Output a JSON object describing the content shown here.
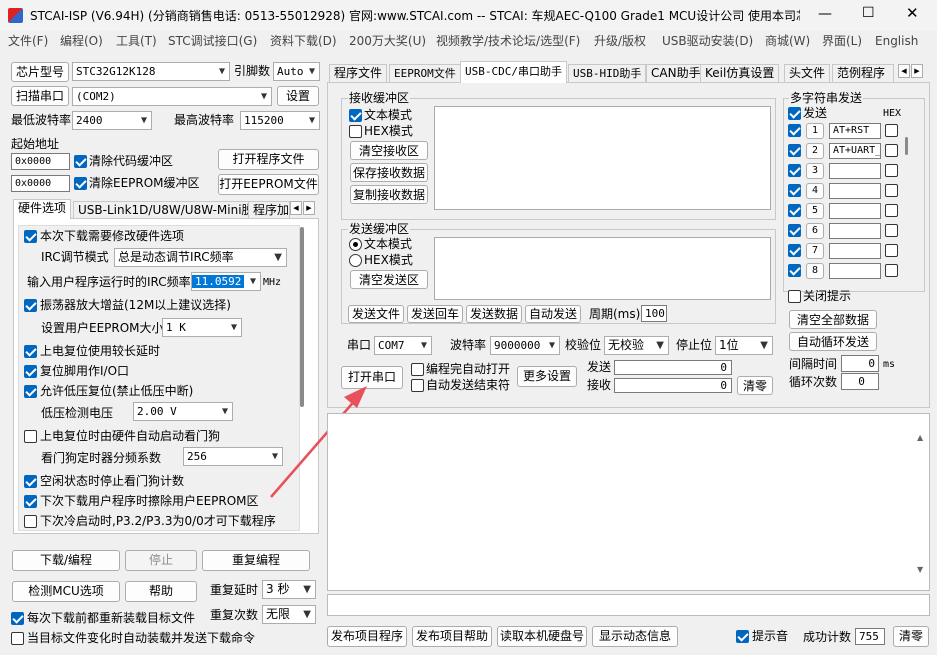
{
  "titlebar": {
    "title": "STCAI-ISP (V6.94H) (分销商销售电话: 0513-55012928) 官网:www.STCAI.com -- STCAI: 车规AEC-Q100 Grade1 MCU设计公司 使用本司芯片或采…"
  },
  "menubar": [
    "文件(F)",
    "编程(O)",
    "工具(T)",
    "STC调试接口(G)",
    "资料下载(D)",
    "200万大奖(U)",
    "视频教学/技术论坛/选型(F)",
    "升级/版权",
    "USB驱动安装(D)",
    "商城(W)",
    "界面(L)",
    "English"
  ],
  "left": {
    "chip_btn": "芯片型号",
    "chip_value": "STC32G12K128",
    "pins_label": "引脚数",
    "pins_value": "Auto",
    "scan_btn": "扫描串口",
    "port_value": "(COM2)",
    "settings_btn": "设置",
    "min_baud_label": "最低波特率",
    "min_baud": "2400",
    "max_baud_label": "最高波特率",
    "max_baud": "115200",
    "start_addr_label": "起始地址",
    "addr1": "0x0000",
    "clear_code": "清除代码缓冲区",
    "open_prog": "打开程序文件",
    "addr2": "0x0000",
    "clear_eeprom": "清除EEPROM缓冲区",
    "open_eeprom": "打开EEPROM文件",
    "tabs": [
      "硬件选项",
      "USB-Link1D/U8W/U8W-Mini脱机",
      "程序加"
    ],
    "hw": {
      "o1": "本次下载需要修改硬件选项",
      "irc_mode_label": "IRC调节模式",
      "irc_mode": "总是动态调节IRC频率",
      "irc_freq_label": "输入用户程序运行时的IRC频率",
      "irc_freq": "11.0592",
      "mhz": "MHz",
      "o2": "振荡器放大增益(12M以上建议选择)",
      "eeprom_size_label": "设置用户EEPROM大小",
      "eeprom_size": "1  K",
      "o3": "上电复位使用较长延时",
      "o4": "复位脚用作I/O口",
      "o5": "允许低压复位(禁止低压中断)",
      "lv_label": "低压检测电压",
      "lv_value": "2.00 V",
      "o6": "上电复位时由硬件自动启动看门狗",
      "wdt_label": "看门狗定时器分频系数",
      "wdt_value": "256",
      "o7": "空闲状态时停止看门狗计数",
      "o8": "下次下载用户程序时擦除用户EEPROM区",
      "o9": "下次冷启动时,P3.2/P3.3为0/0才可下载程序"
    },
    "download_btn": "下载/编程",
    "stop_btn": "停止",
    "reprog_btn": "重复编程",
    "detect_btn": "检测MCU选项",
    "help_btn": "帮助",
    "repeat_delay_label": "重复延时",
    "repeat_delay": "3 秒",
    "repeat_count_label": "重复次数",
    "repeat_count": "无限",
    "reload": "每次下载前都重新装载目标文件",
    "autosend": "当目标文件变化时自动装载并发送下载命令"
  },
  "right": {
    "tabs": [
      "程序文件",
      "EEPROM文件",
      "USB-CDC/串口助手",
      "USB-HID助手",
      "CAN助手",
      "Keil仿真设置",
      "头文件",
      "范例程序"
    ],
    "recv": {
      "title": "接收缓冲区",
      "text_mode": "文本模式",
      "hex_mode": "HEX模式",
      "clear": "清空接收区",
      "save": "保存接收数据",
      "copy": "复制接收数据"
    },
    "send": {
      "title": "发送缓冲区",
      "text_mode": "文本模式",
      "hex_mode": "HEX模式",
      "clear": "清空发送区",
      "send_file": "发送文件",
      "send_enter": "发送回车",
      "send_data": "发送数据",
      "auto_send": "自动发送",
      "period_label": "周期(ms)",
      "period": "100"
    },
    "multi": {
      "title": "多字符串发送",
      "send_label": "发送",
      "hex_label": "HEX",
      "rows": [
        {
          "n": "1",
          "v": "AT+RST"
        },
        {
          "n": "2",
          "v": "AT+UART_"
        },
        {
          "n": "3",
          "v": ""
        },
        {
          "n": "4",
          "v": ""
        },
        {
          "n": "5",
          "v": ""
        },
        {
          "n": "6",
          "v": ""
        },
        {
          "n": "7",
          "v": ""
        },
        {
          "n": "8",
          "v": ""
        }
      ],
      "close_hint": "关闭提示",
      "clear_all": "清空全部数据",
      "auto_loop": "自动循环发送",
      "interval_label": "间隔时间",
      "interval": "0",
      "ms": "ms",
      "loop_label": "循环次数",
      "loop": "0"
    },
    "serial": {
      "port_label": "串口",
      "port": "COM7",
      "baud_label": "波特率",
      "baud": "9000000",
      "parity_label": "校验位",
      "parity": "无校验",
      "stop_label": "停止位",
      "stop": "1位",
      "open_btn": "打开串口",
      "auto_open": "编程完自动打开",
      "auto_close": "自动发送结束符",
      "more_btn": "更多设置",
      "tx_label": "发送",
      "tx": "0",
      "rx_label": "接收",
      "rx": "0",
      "clear_btn": "清零"
    },
    "bottom": {
      "publish_prog": "发布项目程序",
      "publish_help": "发布项目帮助",
      "read_disk": "读取本机硬盘号",
      "show_info": "显示动态信息",
      "beep": "提示音",
      "success_label": "成功计数",
      "success": "755",
      "clear": "清零"
    }
  },
  "colors": {
    "accent": "#0067c0",
    "arrow": "#e8505b"
  }
}
